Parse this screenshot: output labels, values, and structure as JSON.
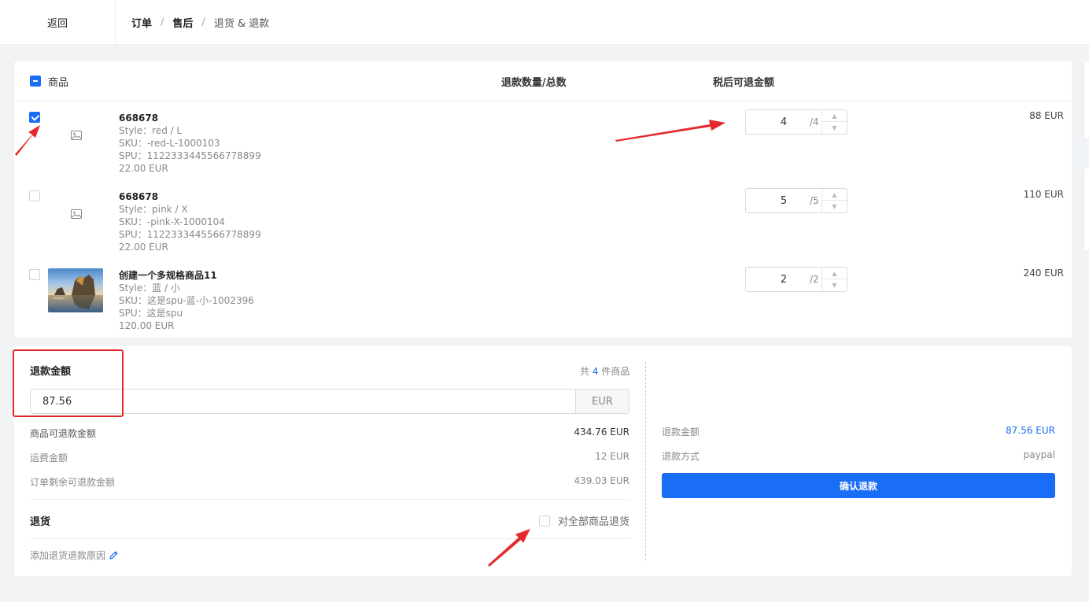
{
  "header": {
    "back_label": "返回",
    "breadcrumb": [
      "订单",
      "售后",
      "退货 & 退款"
    ],
    "separator": "/"
  },
  "products": {
    "header": {
      "product_label": "商品",
      "qty_label": "退款数量/总数",
      "amount_label": "税后可退金额"
    },
    "rows": [
      {
        "checked": true,
        "has_image": false,
        "name": "668678",
        "style": "Style：red / L",
        "sku": "SKU：-red-L-1000103",
        "spu": "SPU：1122333445566778899",
        "price": "22.00 EUR",
        "qty": "4",
        "qty_total": "/4",
        "amount": "88 EUR"
      },
      {
        "checked": false,
        "has_image": false,
        "name": "668678",
        "style": "Style：pink / X",
        "sku": "SKU：-pink-X-1000104",
        "spu": "SPU：1122333445566778899",
        "price": "22.00 EUR",
        "qty": "5",
        "qty_total": "/5",
        "amount": "110 EUR"
      },
      {
        "checked": false,
        "has_image": true,
        "name": "创建一个多规格商品11",
        "style": "Style：蓝 / 小",
        "sku": "SKU：这是spu-蓝-小-1002396",
        "spu": "SPU：这是spu",
        "price": "120.00 EUR",
        "qty": "2",
        "qty_total": "/2",
        "amount": "240 EUR"
      }
    ]
  },
  "refund": {
    "title": "退款金额",
    "count_prefix": "共",
    "count": "4",
    "count_suffix": "件商品",
    "input_value": "87.56",
    "currency": "EUR",
    "refundable_label": "商品可退款金额",
    "refundable_value": "434.76 EUR",
    "shipping_label": "运费金额",
    "shipping_value": "12 EUR",
    "remaining_label": "订单剩余可退款金额",
    "remaining_value": "439.03 EUR",
    "return_title": "退货",
    "return_all_label": "对全部商品退货",
    "reason_label": "添加退货退款原因"
  },
  "summary": {
    "amount_label": "退款金额",
    "amount_value": "87.56 EUR",
    "method_label": "退款方式",
    "method_value": "paypal",
    "confirm_label": "确认退款"
  },
  "colors": {
    "primary": "#1a6ef5",
    "annotation": "#e5282c"
  }
}
